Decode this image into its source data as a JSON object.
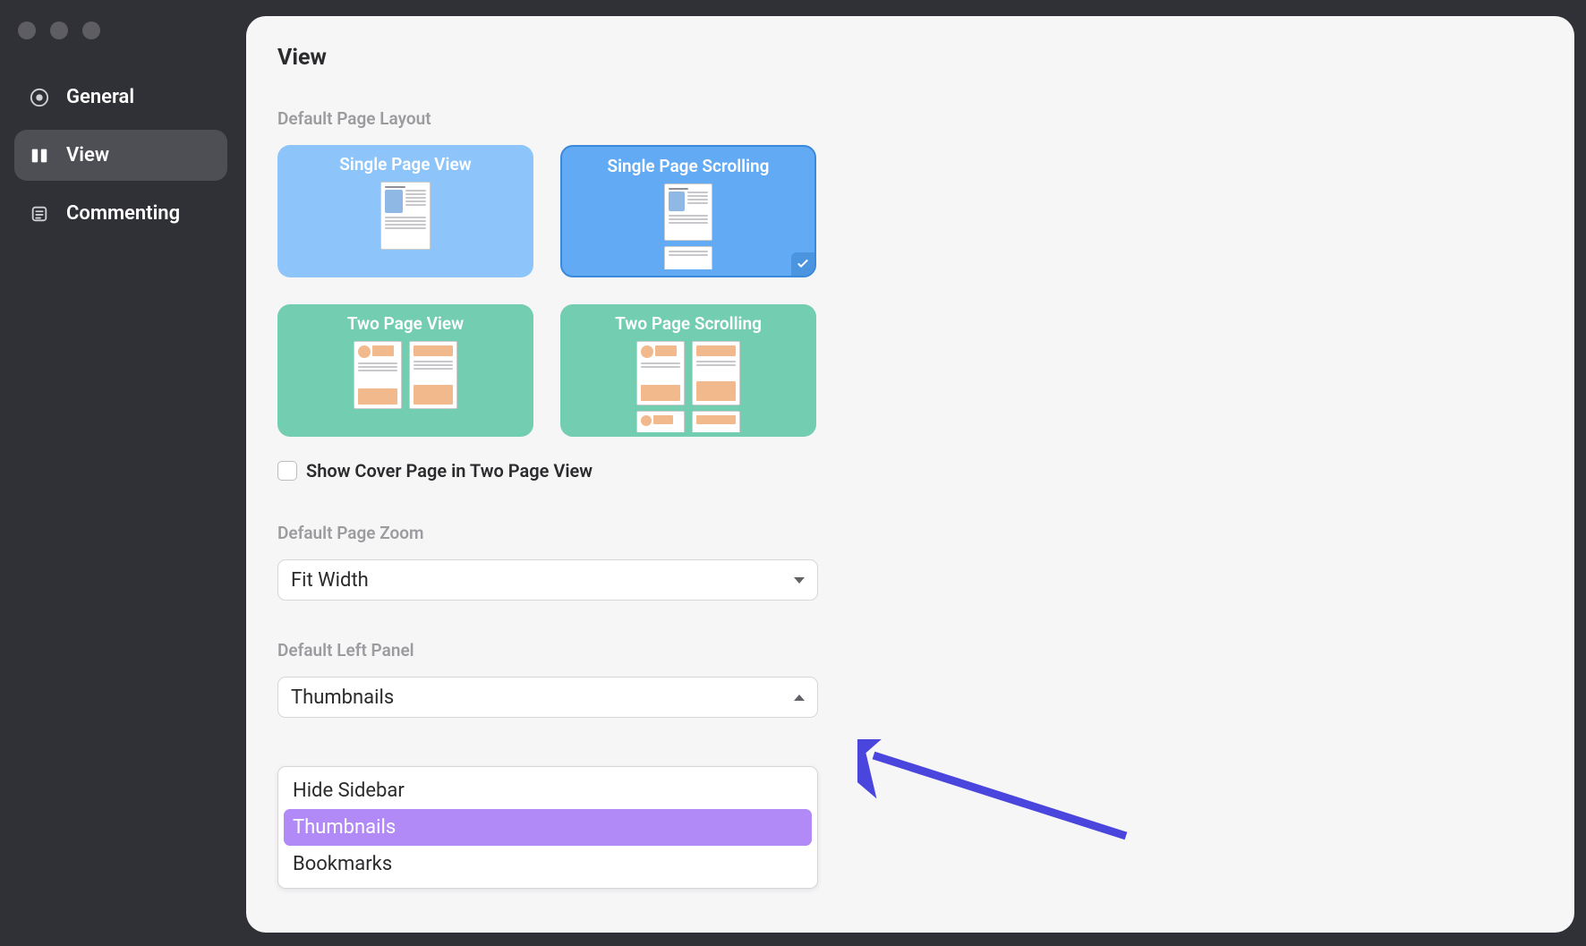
{
  "sidebar": {
    "items": [
      {
        "label": "General",
        "active": false
      },
      {
        "label": "View",
        "active": true
      },
      {
        "label": "Commenting",
        "active": false
      }
    ]
  },
  "page": {
    "title": "View",
    "sections": {
      "layout": {
        "label": "Default Page Layout",
        "options": [
          {
            "label": "Single Page View",
            "selected": false
          },
          {
            "label": "Single Page Scrolling",
            "selected": true
          },
          {
            "label": "Two Page View",
            "selected": false
          },
          {
            "label": "Two Page Scrolling",
            "selected": false
          }
        ],
        "cover_checkbox_label": "Show Cover Page in Two Page View",
        "cover_checked": false
      },
      "zoom": {
        "label": "Default Page Zoom",
        "value": "Fit Width"
      },
      "left_panel": {
        "label": "Default Left Panel",
        "value": "Thumbnails",
        "options": [
          {
            "label": "Hide Sidebar",
            "highlight": false
          },
          {
            "label": "Thumbnails",
            "highlight": true
          },
          {
            "label": "Bookmarks",
            "highlight": false
          }
        ]
      }
    }
  },
  "colors": {
    "sidebar_bg": "#303037",
    "panel_bg": "#f6f6f7",
    "accent_purple": "#b18af7",
    "tile_blue": "#8dc5fa",
    "tile_blue_selected": "#62aaf4",
    "tile_green": "#73cdb1",
    "arrow": "#4a45dd"
  }
}
